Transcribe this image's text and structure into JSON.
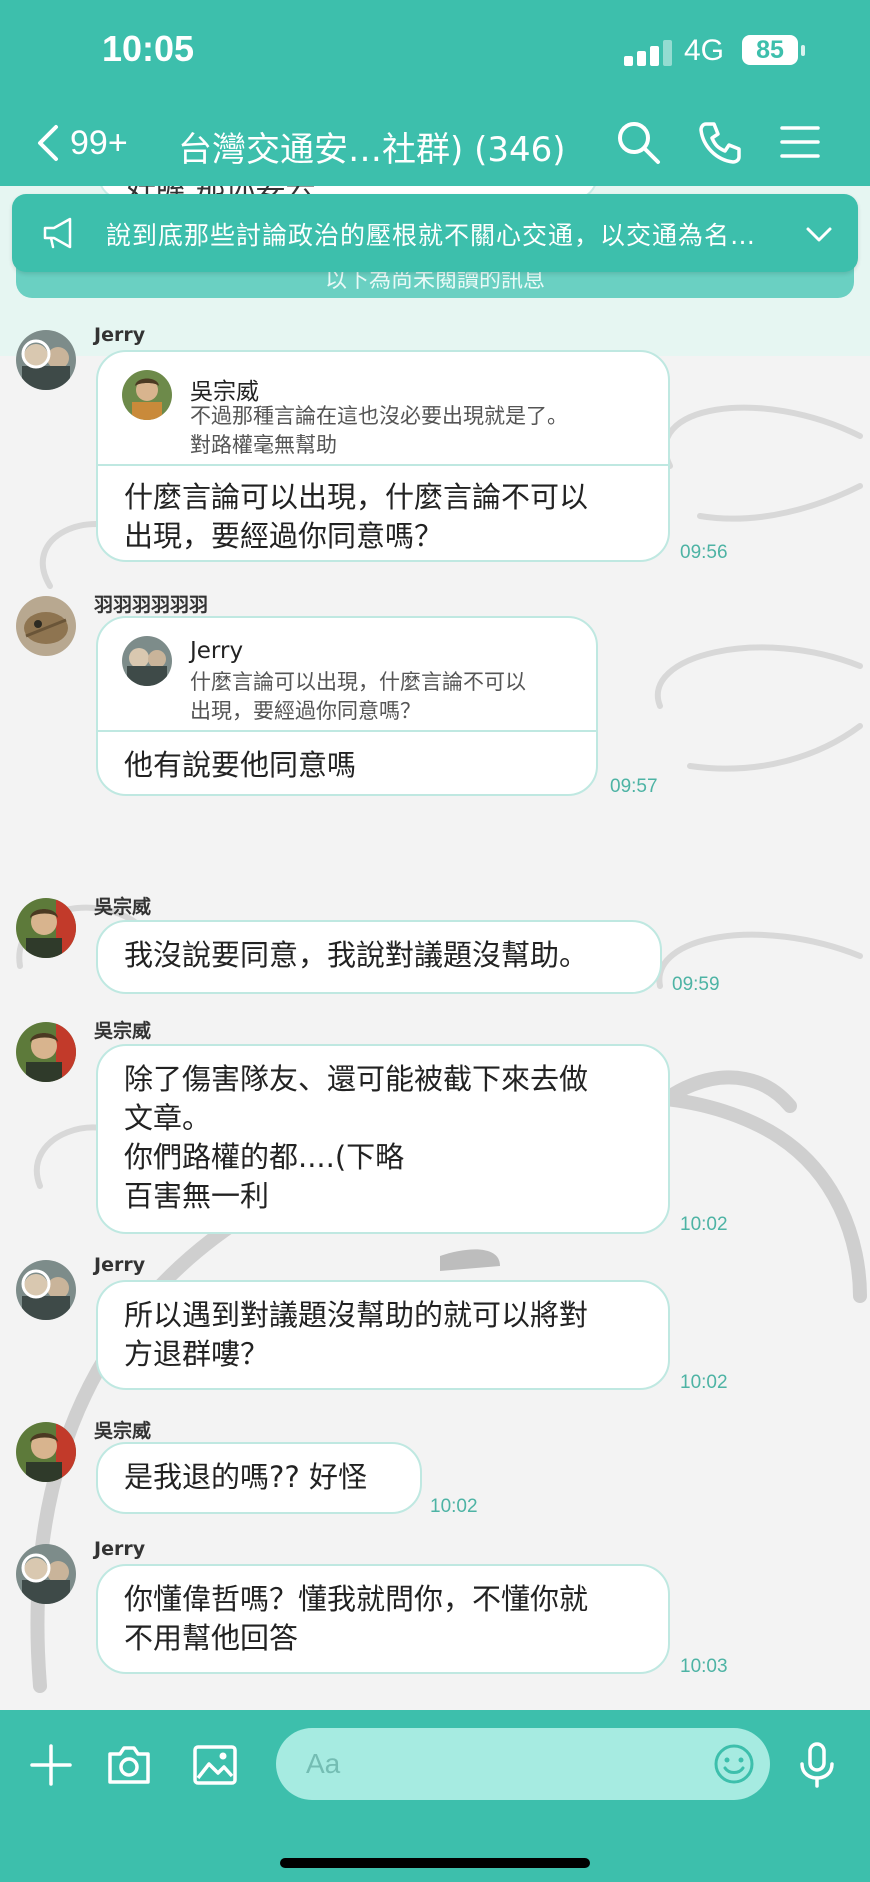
{
  "status_bar": {
    "time": "10:05",
    "network": "4G",
    "battery": "85"
  },
  "header": {
    "back_count": "99+",
    "title": "台灣交通安…社群) (346)",
    "icons": [
      "chevron-left-icon",
      "search-icon",
      "phone-icon",
      "menu-icon"
    ]
  },
  "partial_message": "好喔 那你要去",
  "unread_divider": "以下為尚未閱讀的訊息",
  "announcement": {
    "icon": "megaphone-icon",
    "text": "說到底那些討論政治的壓根就不關心交通，以交通為名行政治之實",
    "expand_icon": "chevron-down-icon"
  },
  "messages": [
    {
      "sender": "Jerry",
      "reply_to": {
        "name": "吳宗威",
        "text": "不過那種言論在這也沒必要出現就是了。\n對路權毫無幫助"
      },
      "text": "什麼言論可以出現，什麼言論不可以\n出現，要經過你同意嗎？",
      "time": "09:56"
    },
    {
      "sender": "羽羽羽羽羽羽",
      "reply_to": {
        "name": "Jerry",
        "text": "什麼言論可以出現，什麼言論不可以\n出現，要經過你同意嗎？"
      },
      "text": "他有說要他同意嗎",
      "time": "09:57"
    },
    {
      "sender": "吳宗威",
      "text": "我沒說要同意，我說對議題沒幫助。",
      "time": "09:59"
    },
    {
      "sender": "吳宗威",
      "text": "除了傷害隊友、還可能被截下來去做\n文章。\n你們路權的都....(下略\n百害無一利",
      "time": "10:02"
    },
    {
      "sender": "Jerry",
      "text": "所以遇到對議題沒幫助的就可以將對\n方退群嘍？",
      "time": "10:02"
    },
    {
      "sender": "吳宗威",
      "text": "是我退的嗎?? 好怪",
      "time": "10:02"
    },
    {
      "sender": "Jerry",
      "text": "你懂偉哲嗎？懂我就問你，不懂你就\n不用幫他回答",
      "time": "10:03"
    }
  ],
  "input_bar": {
    "placeholder": "Aa",
    "icons": [
      "plus-icon",
      "camera-icon",
      "image-icon",
      "emoji-icon",
      "microphone-icon"
    ]
  },
  "colors": {
    "brand": "#3dbfac",
    "bubble_border": "#bfe8e1",
    "time_text": "#4db3a4",
    "input_bg": "#a6ebe1"
  }
}
